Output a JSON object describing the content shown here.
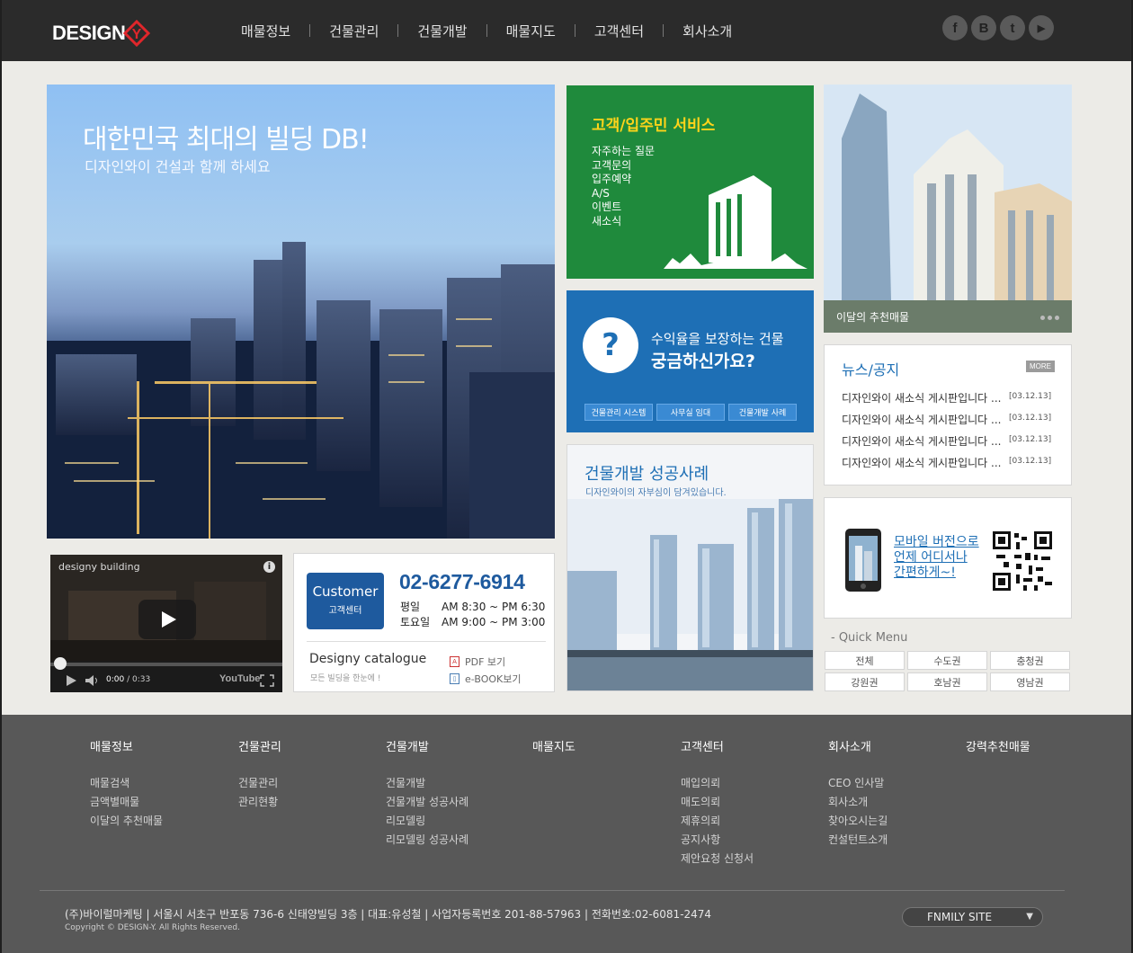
{
  "header": {
    "logo_text": "DESIGN",
    "logo_mark_letter": "Y",
    "nav": [
      "매물정보",
      "건물관리",
      "건물개발",
      "매물지도",
      "고객센터",
      "회사소개"
    ],
    "social": [
      {
        "icon": "facebook-icon",
        "glyph": "f"
      },
      {
        "icon": "blog-icon",
        "glyph": "B"
      },
      {
        "icon": "twitter-icon",
        "glyph": "t"
      },
      {
        "icon": "youtube-icon",
        "glyph": "▶"
      }
    ]
  },
  "hero": {
    "title": "대한민국 최대의 빌딩 DB!",
    "subtitle": "디자인와이 건설과 함께 하세요"
  },
  "service": {
    "title": "고객/입주민 서비스",
    "items": [
      "자주하는 질문",
      "고객문의",
      "입주예약",
      "A/S",
      "이벤트",
      "새소식"
    ]
  },
  "question": {
    "glyph": "?",
    "line1": "수익율을 보장하는 건물",
    "line2": "궁금하신가요?",
    "buttons": [
      "건물관리 시스템",
      "사무실 임대",
      "건물개발 사례"
    ]
  },
  "devcase": {
    "title": "건물개발 성공사례",
    "subtitle": "디자인와이의 자부심이 담겨있습니다."
  },
  "recommend": {
    "caption": "이달의 추천매물"
  },
  "news": {
    "title": "뉴스/공지",
    "more": "MORE",
    "items": [
      {
        "text": "디자인와이 새소식 게시판입니다 ...",
        "date": "[03.12.13]"
      },
      {
        "text": "디자인와이 새소식 게시판입니다 ...",
        "date": "[03.12.13]"
      },
      {
        "text": "디자인와이 새소식 게시판입니다 ...",
        "date": "[03.12.13]"
      },
      {
        "text": "디자인와이 새소식 게시판입니다 ...",
        "date": "[03.12.13]"
      }
    ]
  },
  "mobile": {
    "line1": "모바일 버전으로",
    "line2": "언제 어디서나",
    "line3": "간편하게~!"
  },
  "quick": {
    "label": "- Quick Menu",
    "items": [
      "전체",
      "수도권",
      "충청권",
      "강원권",
      "호남권",
      "영남권"
    ]
  },
  "video": {
    "title": "designy building",
    "time": "0:00",
    "duration": "/ 0:33",
    "brand": "YouTube"
  },
  "customer": {
    "box_title": "Customer",
    "box_sub": "고객센터",
    "phone": "02-6277-6914",
    "weekday_label": "평일",
    "weekday_hours": "AM 8:30 ~ PM 6:30",
    "sat_label": "토요일",
    "sat_hours": "AM 9:00 ~ PM 3:00",
    "catalogue_title": "Designy catalogue",
    "catalogue_sub": "모든 빌딩을 한눈에 !",
    "pdf": "PDF 보기",
    "ebook": "e-BOOK보기"
  },
  "footer": {
    "columns": [
      {
        "head": "매물정보",
        "items": [
          "매물검색",
          "금액별매물",
          "이달의 추천매물"
        ]
      },
      {
        "head": "건물관리",
        "items": [
          "건물관리",
          "관리현황"
        ]
      },
      {
        "head": "건물개발",
        "items": [
          "건물개발",
          "건물개발 성공사례",
          "리모델링",
          "리모델링 성공사례"
        ]
      },
      {
        "head": "매물지도",
        "items": []
      },
      {
        "head": "고객센터",
        "items": [
          "매입의뢰",
          "매도의뢰",
          "제휴의뢰",
          "공지사항",
          "제안요청 신청서"
        ]
      },
      {
        "head": "회사소개",
        "items": [
          "CEO 인사말",
          "회사소개",
          "찾아오시는길",
          "컨설턴트소개"
        ]
      },
      {
        "head": "강력추천매물",
        "items": []
      }
    ],
    "address": "(주)바이럴마케팅  |  서울시 서초구 반포동 736-6 신태양빌딩 3층  |  대표:유성철   |  사업자등록번호 201-88-57963  |  전화번호:02-6081-2474",
    "copyright": "Copyright © DESIGN-Y. All Rights Reserved.",
    "family_site": "FNMILY SITE",
    "family_arrow": "▼"
  },
  "colors": {
    "header_bg": "#2b2b2b",
    "accent_blue": "#1e6fb5",
    "accent_green": "#1f8a3c",
    "accent_yellow": "#ffd41a",
    "logo_red": "#e0262b",
    "footer_bg": "#585858"
  }
}
